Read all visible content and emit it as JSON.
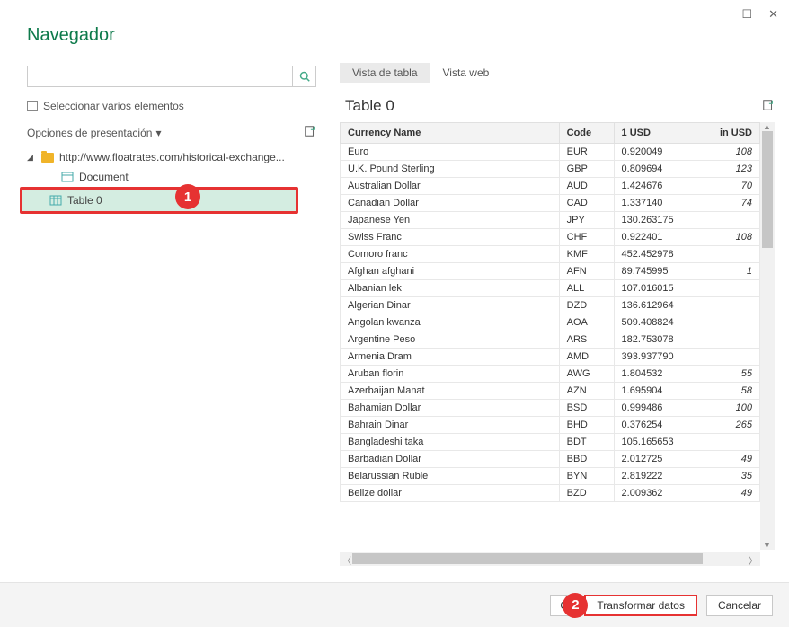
{
  "window": {
    "maximize_glyph": "☐",
    "close_glyph": "✕"
  },
  "title": "Navegador",
  "search": {
    "placeholder": ""
  },
  "multiSelect": {
    "label": "Seleccionar varios elementos"
  },
  "options": {
    "label": "Opciones de presentación",
    "caret": "▾"
  },
  "tree": {
    "root_label": "http://www.floatrates.com/historical-exchange...",
    "items": [
      {
        "label": "Document",
        "type": "doc"
      },
      {
        "label": "Table 0",
        "type": "table",
        "selected": true
      }
    ]
  },
  "badges": {
    "one": "1",
    "two": "2"
  },
  "tabs": {
    "table_view": "Vista de tabla",
    "web_view": "Vista web"
  },
  "table": {
    "title": "Table 0",
    "headers": {
      "name": "Currency Name",
      "code": "Code",
      "one_usd": "1 USD",
      "in_usd": "in USD"
    },
    "rows": [
      {
        "name": "Euro",
        "code": "EUR",
        "usd": "0.920049",
        "inusd": "108"
      },
      {
        "name": "U.K. Pound Sterling",
        "code": "GBP",
        "usd": "0.809694",
        "inusd": "123"
      },
      {
        "name": "Australian Dollar",
        "code": "AUD",
        "usd": "1.424676",
        "inusd": "70"
      },
      {
        "name": "Canadian Dollar",
        "code": "CAD",
        "usd": "1.337140",
        "inusd": "74"
      },
      {
        "name": "Japanese Yen",
        "code": "JPY",
        "usd": "130.263175",
        "inusd": ""
      },
      {
        "name": "Swiss Franc",
        "code": "CHF",
        "usd": "0.922401",
        "inusd": "108"
      },
      {
        "name": "Comoro franc",
        "code": "KMF",
        "usd": "452.452978",
        "inusd": ""
      },
      {
        "name": "Afghan afghani",
        "code": "AFN",
        "usd": "89.745995",
        "inusd": "1"
      },
      {
        "name": "Albanian lek",
        "code": "ALL",
        "usd": "107.016015",
        "inusd": ""
      },
      {
        "name": "Algerian Dinar",
        "code": "DZD",
        "usd": "136.612964",
        "inusd": ""
      },
      {
        "name": "Angolan kwanza",
        "code": "AOA",
        "usd": "509.408824",
        "inusd": ""
      },
      {
        "name": "Argentine Peso",
        "code": "ARS",
        "usd": "182.753078",
        "inusd": ""
      },
      {
        "name": "Armenia Dram",
        "code": "AMD",
        "usd": "393.937790",
        "inusd": ""
      },
      {
        "name": "Aruban florin",
        "code": "AWG",
        "usd": "1.804532",
        "inusd": "55"
      },
      {
        "name": "Azerbaijan Manat",
        "code": "AZN",
        "usd": "1.695904",
        "inusd": "58"
      },
      {
        "name": "Bahamian Dollar",
        "code": "BSD",
        "usd": "0.999486",
        "inusd": "100"
      },
      {
        "name": "Bahrain Dinar",
        "code": "BHD",
        "usd": "0.376254",
        "inusd": "265"
      },
      {
        "name": "Bangladeshi taka",
        "code": "BDT",
        "usd": "105.165653",
        "inusd": ""
      },
      {
        "name": "Barbadian Dollar",
        "code": "BBD",
        "usd": "2.012725",
        "inusd": "49"
      },
      {
        "name": "Belarussian Ruble",
        "code": "BYN",
        "usd": "2.819222",
        "inusd": "35"
      },
      {
        "name": "Belize dollar",
        "code": "BZD",
        "usd": "2.009362",
        "inusd": "49"
      }
    ]
  },
  "footer": {
    "load": "Cargar",
    "transform": "Transformar datos",
    "cancel": "Cancelar",
    "caret": "▾"
  }
}
